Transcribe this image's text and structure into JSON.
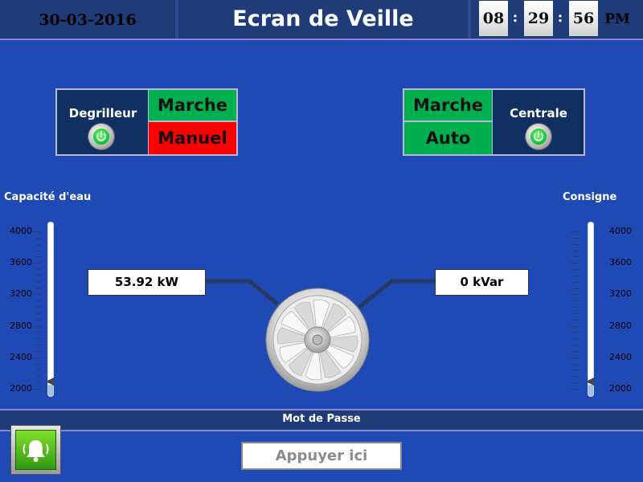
{
  "header": {
    "date": "30-03-2016",
    "title": "Ecran de Veille",
    "clock": {
      "hours": "08",
      "minutes": "29",
      "seconds": "56",
      "ampm": "PM",
      "separator": ":"
    }
  },
  "left_panel": {
    "label": "Degrilleur",
    "state_top": "Marche",
    "state_bottom": "Manuel"
  },
  "right_panel": {
    "label": "Centrale",
    "state_top": "Marche",
    "state_bottom": "Auto"
  },
  "left_gauge": {
    "title": "Capacité d'eau",
    "ticks": [
      "4000",
      "3600",
      "3200",
      "2800",
      "2400",
      "2000"
    ],
    "level_value": 2000
  },
  "right_gauge": {
    "title": "Consigne",
    "ticks": [
      "4000",
      "3600",
      "3200",
      "2800",
      "2400",
      "2000"
    ],
    "level_value": 2000
  },
  "power_value": "53.92 kW",
  "reactive_value": "0 kVar",
  "footer": {
    "password_label": "Mot de Passe",
    "press_button": "Appuyer ici"
  },
  "colors": {
    "background": "#1f49b4",
    "header": "#1f3c79",
    "status_green": "#00b050",
    "status_red": "#ff0000"
  },
  "icons": [
    "power-icon",
    "alarm-bell-icon",
    "fan-icon"
  ]
}
